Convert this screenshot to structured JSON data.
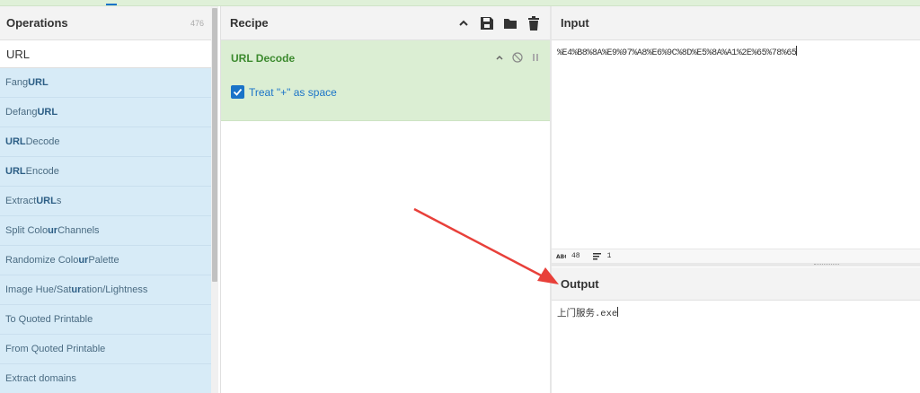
{
  "operations": {
    "title": "Operations",
    "count": "476",
    "search_value": "URL",
    "items": [
      {
        "pre": "Fang ",
        "hl": "URL",
        "post": ""
      },
      {
        "pre": "Defang ",
        "hl": "URL",
        "post": ""
      },
      {
        "pre": "",
        "hl": "URL",
        "post": " Decode"
      },
      {
        "pre": "",
        "hl": "URL",
        "post": " Encode"
      },
      {
        "pre": "Extract ",
        "hl": "URL",
        "post": "s"
      },
      {
        "pre": "Split Colo",
        "hl": "ur",
        "post": " Channels"
      },
      {
        "pre": "Randomize Colo",
        "hl": "ur",
        "post": " Palette"
      },
      {
        "pre": "Image Hue/Sat",
        "hl": "ur",
        "post": "ation/Lightness"
      },
      {
        "pre": "To Quoted Printable",
        "hl": "",
        "post": ""
      },
      {
        "pre": "From Quoted Printable",
        "hl": "",
        "post": ""
      },
      {
        "pre": "Extract domains",
        "hl": "",
        "post": ""
      }
    ]
  },
  "recipe": {
    "title": "Recipe",
    "operation_name": "URL Decode",
    "option_label": "Treat \"+\" as space",
    "option_checked": true
  },
  "input": {
    "title": "Input",
    "value": "%E4%B8%8A%E9%97%A8%E6%9C%8D%E5%8A%A1%2E%65%78%65",
    "status_chars_icon": "abc-icon",
    "status_chars": "48",
    "status_lines": "1"
  },
  "output": {
    "title": "Output",
    "value": "上门服务.exe"
  },
  "colors": {
    "recipe_bg": "#dbeed3",
    "ops_bg": "#d7ebf7",
    "accent_blue": "#1a73c8",
    "annotation_arrow": "#e8403a"
  }
}
